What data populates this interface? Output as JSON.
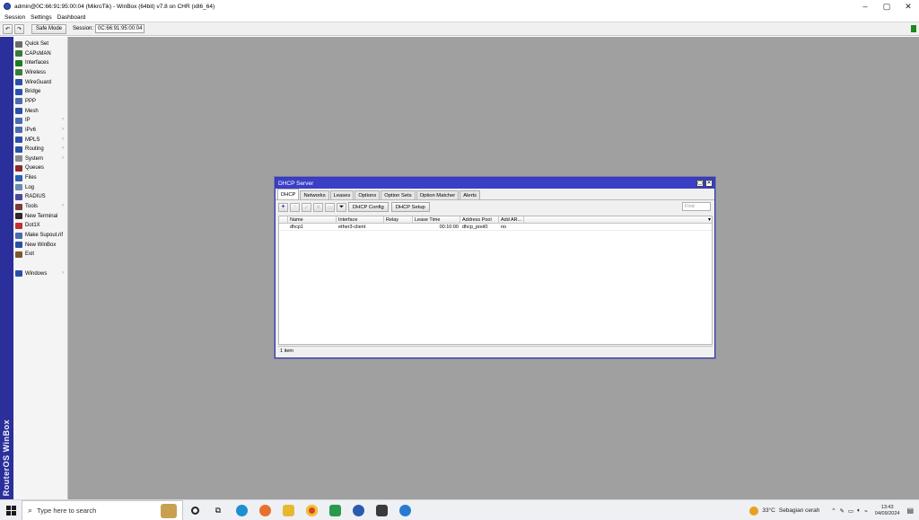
{
  "window": {
    "title": "admin@0C:66:91:95:00:04 (MikroTik) - WinBox (64bit) v7.8 on CHR (x86_64)",
    "controls": [
      "–",
      "▢",
      "✕"
    ]
  },
  "menubar": {
    "items": [
      "Session",
      "Settings",
      "Dashboard"
    ]
  },
  "toolbar": {
    "undo": "↶",
    "redo": "↷",
    "safe_mode": "Safe Mode",
    "session_label": "Session:",
    "session_value": "0C:66:91:95:00:04"
  },
  "brand": {
    "text": "RouterOS WinBox"
  },
  "sidebar": {
    "items": [
      {
        "label": "Quick Set",
        "icon": "wand-icon",
        "color": "#6a6a6a",
        "submenu": false
      },
      {
        "label": "CAPsMAN",
        "icon": "capsman-icon",
        "color": "#3a7a3a",
        "submenu": false
      },
      {
        "label": "Interfaces",
        "icon": "interfaces-icon",
        "color": "#1f7a1f",
        "submenu": false
      },
      {
        "label": "Wireless",
        "icon": "wireless-icon",
        "color": "#3a7a3a",
        "submenu": false
      },
      {
        "label": "WireGuard",
        "icon": "wireguard-icon",
        "color": "#2b4fa8",
        "submenu": false
      },
      {
        "label": "Bridge",
        "icon": "bridge-icon",
        "color": "#2b4fa8",
        "submenu": false
      },
      {
        "label": "PPP",
        "icon": "ppp-icon",
        "color": "#4a6ab0",
        "submenu": false
      },
      {
        "label": "Mesh",
        "icon": "mesh-icon",
        "color": "#2b4fa8",
        "submenu": false
      },
      {
        "label": "IP",
        "icon": "ip-icon",
        "color": "#4a6ab0",
        "submenu": true
      },
      {
        "label": "IPv6",
        "icon": "ipv6-icon",
        "color": "#4a6ab0",
        "submenu": true
      },
      {
        "label": "MPLS",
        "icon": "mpls-icon",
        "color": "#2b4fa8",
        "submenu": true
      },
      {
        "label": "Routing",
        "icon": "routing-icon",
        "color": "#2b4fa8",
        "submenu": true
      },
      {
        "label": "System",
        "icon": "system-icon",
        "color": "#8a8a8a",
        "submenu": true
      },
      {
        "label": "Queues",
        "icon": "queues-icon",
        "color": "#8a2a2a",
        "submenu": false
      },
      {
        "label": "Files",
        "icon": "files-icon",
        "color": "#2b5fb0",
        "submenu": false
      },
      {
        "label": "Log",
        "icon": "log-icon",
        "color": "#6a8ab0",
        "submenu": false
      },
      {
        "label": "RADIUS",
        "icon": "radius-icon",
        "color": "#4a4a9a",
        "submenu": false
      },
      {
        "label": "Tools",
        "icon": "tools-icon",
        "color": "#7a3a3a",
        "submenu": true
      },
      {
        "label": "New Terminal",
        "icon": "terminal-icon",
        "color": "#2a2a2a",
        "submenu": false
      },
      {
        "label": "Dot1X",
        "icon": "dot1x-icon",
        "color": "#c03030",
        "submenu": false
      },
      {
        "label": "Make Supout.rif",
        "icon": "supout-icon",
        "color": "#4a6ab0",
        "submenu": false
      },
      {
        "label": "New WinBox",
        "icon": "winbox-icon",
        "color": "#2b4fa8",
        "submenu": false
      },
      {
        "label": "Exit",
        "icon": "exit-icon",
        "color": "#7a5a2a",
        "submenu": false
      },
      {
        "label": "Windows",
        "icon": "windows-icon",
        "color": "#2b4fa8",
        "submenu": true
      }
    ]
  },
  "dhcp_window": {
    "title": "DHCP Server",
    "tabs": [
      "DHCP",
      "Networks",
      "Leases",
      "Options",
      "Option Sets",
      "Option Matcher",
      "Alerts"
    ],
    "active_tab": "DHCP",
    "buttons": {
      "dhcp_config": "DHCP Config",
      "dhcp_setup": "DHCP Setup"
    },
    "find_placeholder": "Find",
    "columns": [
      "Name",
      "Interface",
      "Relay",
      "Lease Time",
      "Address Pool",
      "Add AR..."
    ],
    "rows": [
      {
        "name": "dhcp1",
        "interface": "ether3-client",
        "relay": "",
        "lease_time": "00:10:00",
        "address_pool": "dhcp_pool0",
        "add_arp": "no"
      }
    ],
    "status": "1 item"
  },
  "taskbar": {
    "search_placeholder": "Type here to search",
    "weather_temp": "33°C",
    "weather_desc": "Sebagian cerah",
    "time": "13:43",
    "date": "04/09/2024",
    "tray_chevron": "^"
  }
}
